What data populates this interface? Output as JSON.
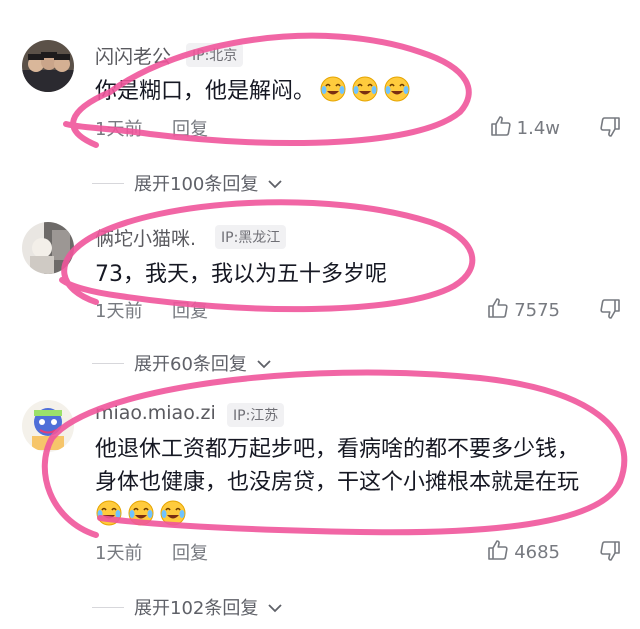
{
  "comments": [
    {
      "nickname": "闪闪老公",
      "ip": "IP:北京",
      "text": "你是糊口，他是解闷。",
      "emoji_count": 3,
      "emoji": "crying-laughing-emoji",
      "time": "1天前",
      "reply_label": "回复",
      "likes": "1.4w",
      "expand_label": "展开100条回复"
    },
    {
      "nickname": "俩坨小猫咪.",
      "ip": "IP:黑龙江",
      "text": "73，我天，我以为五十多岁呢",
      "emoji_count": 0,
      "time": "1天前",
      "reply_label": "回复",
      "likes": "7575",
      "expand_label": "展开60条回复"
    },
    {
      "nickname": "miao.miao.zi",
      "ip": "IP:江苏",
      "text_line1": "他退休工资都万起步吧，看病啥的都不要多少钱，",
      "text_line2": "身体也健康，也没房贷，干这个小摊根本就是在玩",
      "emoji_count": 3,
      "emoji": "crying-laughing-emoji",
      "time": "1天前",
      "reply_label": "回复",
      "likes": "4685",
      "expand_label": "展开102条回复"
    }
  ],
  "icons": {
    "like": "thumbs-up-icon",
    "dislike": "thumbs-down-icon",
    "expand": "chevron-down-icon"
  },
  "colors": {
    "annotation": "#f0559b",
    "ip_tag_bg": "#f1f1f3",
    "meta_text": "#777a80"
  }
}
